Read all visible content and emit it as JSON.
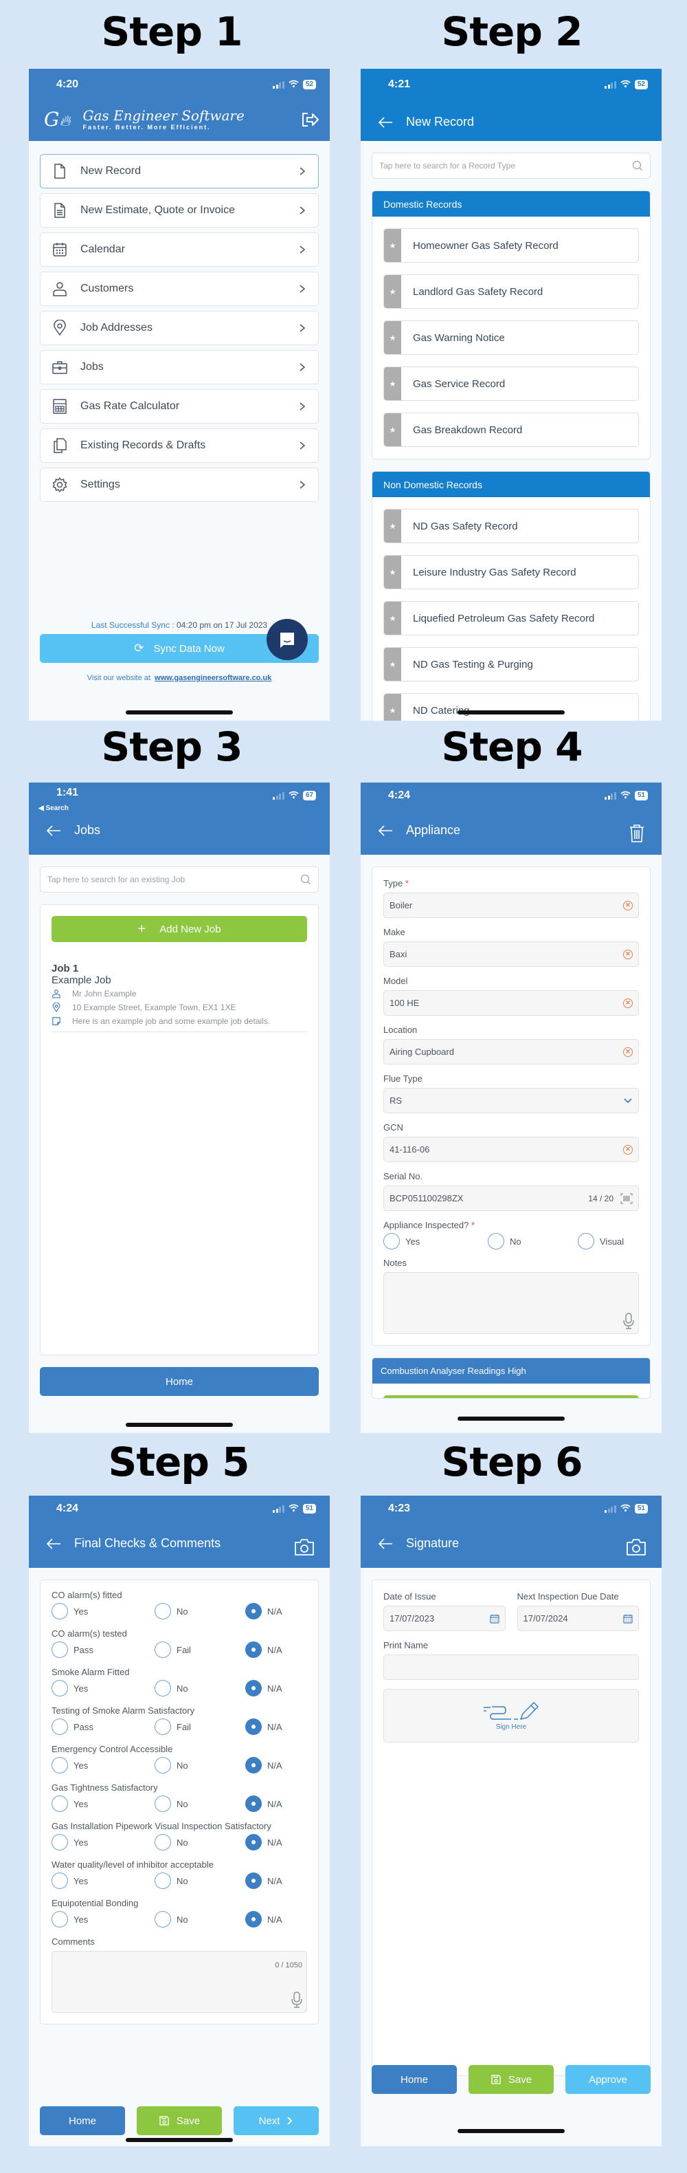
{
  "steps": [
    "Step 1",
    "Step 2",
    "Step 3",
    "Step 4",
    "Step 5",
    "Step 6"
  ],
  "colors": {
    "primary": "#3c7fc4",
    "primary_alt": "#1480cd",
    "green": "#8dc63f",
    "light_blue": "#56c1f3",
    "error": "#e8502e",
    "background": "#d6e6f7"
  },
  "step1": {
    "status": {
      "time": "4:20",
      "battery": "52"
    },
    "logo_title": "Gas Engineer Software",
    "logo_tagline": "Faster. Better. More Efficient.",
    "logout_icon": "logout-icon",
    "menu": [
      {
        "label": "New Record",
        "icon": "document-icon"
      },
      {
        "label": "New Estimate, Quote or Invoice",
        "icon": "invoice-icon"
      },
      {
        "label": "Calendar",
        "icon": "calendar-icon"
      },
      {
        "label": "Customers",
        "icon": "user-icon"
      },
      {
        "label": "Job Addresses",
        "icon": "location-pin-icon"
      },
      {
        "label": "Jobs",
        "icon": "briefcase-icon"
      },
      {
        "label": "Gas Rate Calculator",
        "icon": "calculator-icon"
      },
      {
        "label": "Existing Records & Drafts",
        "icon": "copy-icon"
      },
      {
        "label": "Settings",
        "icon": "gear-icon"
      }
    ],
    "sync_label": "Last Successful Sync :",
    "sync_time": "04:20 pm on 17 Jul 2023",
    "sync_button": "Sync Data Now",
    "website_prefix": "Visit our website at",
    "website_link": "www.gasengineersoftware.co.uk"
  },
  "step2": {
    "status": {
      "time": "4:21",
      "battery": "52"
    },
    "title": "New Record",
    "search_placeholder": "Tap here to search for a Record Type",
    "domestic_title": "Domestic Records",
    "domestic": [
      "Homeowner Gas Safety Record",
      "Landlord Gas Safety Record",
      "Gas Warning Notice",
      "Gas Service Record",
      "Gas Breakdown Record"
    ],
    "non_domestic_title": "Non Domestic Records",
    "non_domestic": [
      "ND Gas Safety Record",
      "Leisure Industry Gas Safety Record",
      "Liquefied Petroleum Gas Safety Record",
      "ND Gas Testing & Purging",
      "ND Catering"
    ]
  },
  "step3": {
    "status": {
      "time": "1:41",
      "battery": "67",
      "back_label": "Search"
    },
    "title": "Jobs",
    "search_placeholder": "Tap here to search for an existing Job",
    "add_button": "Add New Job",
    "job": {
      "number": "Job 1",
      "name": "Example Job",
      "customer": "Mr John Example",
      "address": "10 Example Street, Example Town, EX1 1XE",
      "details": "Here is an example job and some example job details."
    },
    "home_button": "Home"
  },
  "step4": {
    "status": {
      "time": "4:24",
      "battery": "51"
    },
    "title": "Appliance",
    "fields": [
      {
        "label": "Type",
        "value": "Boiler",
        "required": true,
        "control": "clear"
      },
      {
        "label": "Make",
        "value": "Baxi",
        "control": "clear"
      },
      {
        "label": "Model",
        "value": "100 HE",
        "control": "clear"
      },
      {
        "label": "Location",
        "value": "Airing Cupboard",
        "control": "clear"
      },
      {
        "label": "Flue Type",
        "value": "RS",
        "control": "dropdown"
      },
      {
        "label": "GCN",
        "value": "41-116-06",
        "control": "clear"
      },
      {
        "label": "Serial No.",
        "value": "BCP051100298ZX",
        "counter": "14 / 20",
        "control": "barcode"
      }
    ],
    "inspected_label": "Appliance Inspected?",
    "inspected_options": [
      "Yes",
      "No",
      "Visual"
    ],
    "notes_label": "Notes",
    "next_section": "Combustion Analyser Readings High"
  },
  "step5": {
    "status": {
      "time": "4:24",
      "battery": "51"
    },
    "title": "Final Checks & Comments",
    "checks": [
      {
        "label": "CO alarm(s) fitted",
        "options": [
          "Yes",
          "No",
          "N/A"
        ],
        "selected": 2
      },
      {
        "label": "CO alarm(s) tested",
        "options": [
          "Pass",
          "Fail",
          "N/A"
        ],
        "selected": 2
      },
      {
        "label": "Smoke Alarm Fitted",
        "options": [
          "Yes",
          "No",
          "N/A"
        ],
        "selected": 2
      },
      {
        "label": "Testing of Smoke Alarm Satisfactory",
        "options": [
          "Pass",
          "Fail",
          "N/A"
        ],
        "selected": 2
      },
      {
        "label": "Emergency Control Accessible",
        "options": [
          "Yes",
          "No",
          "N/A"
        ],
        "selected": 2
      },
      {
        "label": "Gas Tightness Satisfactory",
        "options": [
          "Yes",
          "No",
          "N/A"
        ],
        "selected": 2
      },
      {
        "label": "Gas Installation Pipework Visual Inspection Satisfactory",
        "options": [
          "Yes",
          "No",
          "N/A"
        ],
        "selected": 2
      },
      {
        "label": "Water quality/level of inhibitor acceptable",
        "options": [
          "Yes",
          "No",
          "N/A"
        ],
        "selected": 2
      },
      {
        "label": "Equipotential Bonding",
        "options": [
          "Yes",
          "No",
          "N/A"
        ],
        "selected": 2
      }
    ],
    "comments_label": "Comments",
    "comments_counter": "0 / 1050",
    "buttons": {
      "home": "Home",
      "save": "Save",
      "next": "Next"
    }
  },
  "step6": {
    "status": {
      "time": "4:23",
      "battery": "51"
    },
    "title": "Signature",
    "date_issue_label": "Date of Issue",
    "date_issue": "17/07/2023",
    "next_due_label": "Next Inspection Due Date",
    "next_due": "17/07/2024",
    "print_name_label": "Print Name",
    "print_name": "",
    "sign_here": "Sign Here",
    "buttons": {
      "home": "Home",
      "save": "Save",
      "approve": "Approve"
    }
  }
}
